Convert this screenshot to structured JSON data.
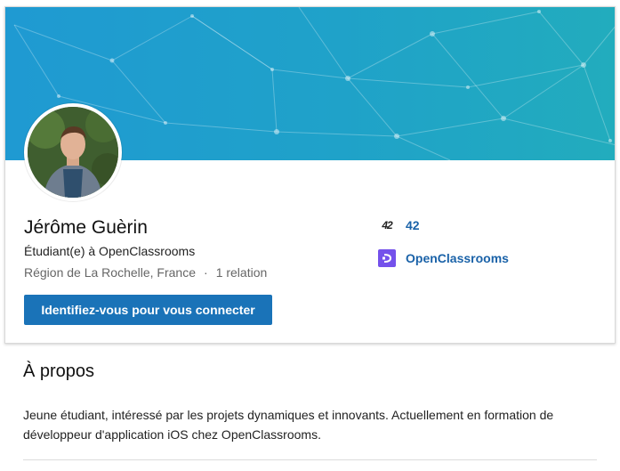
{
  "profile": {
    "name": "Jérôme Guèrin",
    "headline": "Étudiant(e) à OpenClassrooms",
    "location": "Région de La Rochelle, France",
    "separator": "·",
    "connections": "1 relation",
    "cta_label": "Identifiez-vous pour vous connecter"
  },
  "experience": [
    {
      "logo": "42-logo",
      "name": "42"
    },
    {
      "logo": "openclassrooms-logo",
      "name": "OpenClassrooms"
    }
  ],
  "about": {
    "title": "À propos",
    "text": "Jeune étudiant, intéressé par les projets dynamiques et innovants. Actuellement en formation de développeur d'application iOS chez OpenClassrooms."
  },
  "colors": {
    "banner": "#1f9ad2",
    "cta": "#1a73b8",
    "link": "#1a62a8",
    "openclassrooms_brand": "#7451eb"
  }
}
